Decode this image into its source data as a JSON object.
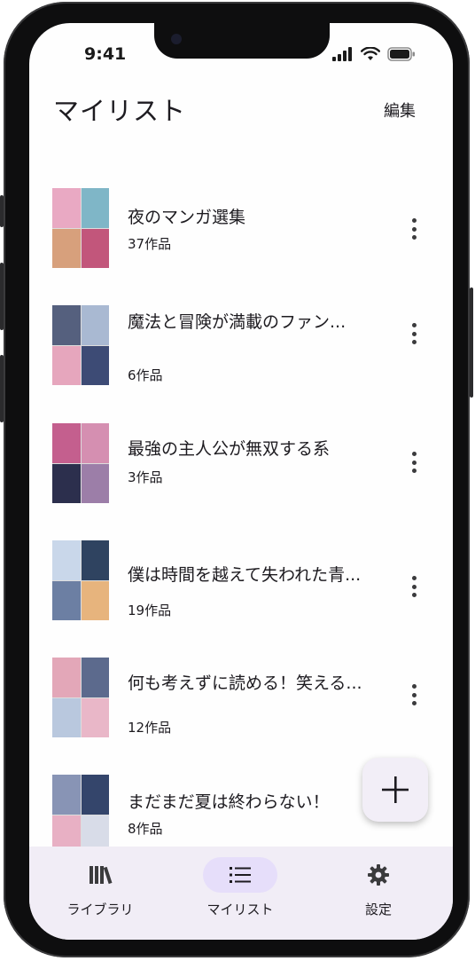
{
  "status_bar": {
    "time": "9:41"
  },
  "header": {
    "title": "マイリスト",
    "edit_label": "編集"
  },
  "lists": [
    {
      "title": "夜のマンガ選集",
      "count": "37作品"
    },
    {
      "title": "魔法と冒険が満載のファン...",
      "count": "6作品"
    },
    {
      "title": "最強の主人公が無双する系",
      "count": "3作品"
    },
    {
      "title": "僕は時間を越えて失われた青...",
      "count": "19作品"
    },
    {
      "title": "何も考えずに読める！笑える...",
      "count": "12作品"
    },
    {
      "title": "まだまだ夏は終わらない！",
      "count": "8作品"
    }
  ],
  "fab": {
    "icon": "plus-icon"
  },
  "bottom_nav": {
    "items": [
      {
        "label": "ライブラリ",
        "icon": "library-icon",
        "active": false
      },
      {
        "label": "マイリスト",
        "icon": "list-icon",
        "active": true
      },
      {
        "label": "設定",
        "icon": "gear-icon",
        "active": false
      }
    ]
  },
  "colors": {
    "accent_pill": "#e6defa",
    "nav_bg": "#f1edf6",
    "fab_bg": "#f2eef7"
  }
}
